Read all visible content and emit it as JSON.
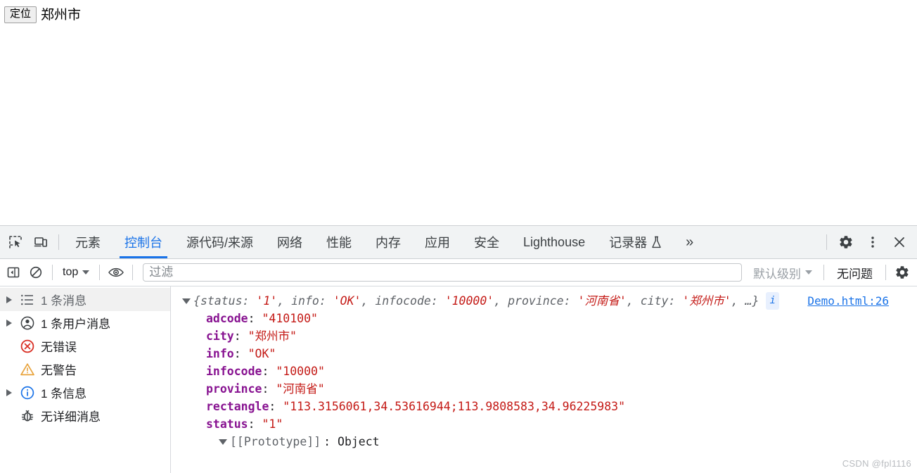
{
  "page": {
    "locate_button": "定位",
    "city_text": "郑州市"
  },
  "devtools": {
    "tabs": [
      {
        "label": "元素",
        "active": false
      },
      {
        "label": "控制台",
        "active": true
      },
      {
        "label": "源代码/来源",
        "active": false
      },
      {
        "label": "网络",
        "active": false
      },
      {
        "label": "性能",
        "active": false
      },
      {
        "label": "内存",
        "active": false
      },
      {
        "label": "应用",
        "active": false
      },
      {
        "label": "安全",
        "active": false
      },
      {
        "label": "Lighthouse",
        "active": false
      },
      {
        "label": "记录器",
        "active": false,
        "icon": "flask-icon"
      }
    ],
    "more_tabs": "»",
    "icons": {
      "inspect": "inspect-element-icon",
      "device": "device-toolbar-icon",
      "settings": "gear-icon",
      "kebab": "more-options-icon",
      "close": "close-icon"
    }
  },
  "console_toolbar": {
    "sidebar_toggle": "console-sidebar-toggle-icon",
    "clear": "clear-console-icon",
    "context": "top",
    "eye": "live-expression-icon",
    "filter_placeholder": "过滤",
    "filter_value": "",
    "level": "默认级别",
    "issues": "无问题",
    "settings": "gear-icon"
  },
  "sidebar": {
    "items": [
      {
        "label": "1 条消息",
        "icon": "list-icon",
        "expandable": true,
        "selected": true
      },
      {
        "label": "1 条用户消息",
        "icon": "user-icon",
        "expandable": true,
        "selected": false
      },
      {
        "label": "无错误",
        "icon": "error-icon",
        "expandable": false,
        "selected": false
      },
      {
        "label": "无警告",
        "icon": "warning-icon",
        "expandable": false,
        "selected": false
      },
      {
        "label": "1 条信息",
        "icon": "info-icon",
        "expandable": true,
        "selected": false
      },
      {
        "label": "无详细消息",
        "icon": "verbose-bug-icon",
        "expandable": false,
        "selected": false
      }
    ]
  },
  "console": {
    "source_link": "Demo.html:26",
    "info_badge": "i",
    "preview": {
      "open": "{",
      "parts": [
        {
          "key": "status: ",
          "value": "'1'"
        },
        {
          "key": "info: ",
          "value": "'OK'"
        },
        {
          "key": "infocode: ",
          "value": "'10000'"
        },
        {
          "key": "province: ",
          "value": "'河南省'"
        },
        {
          "key": "city: ",
          "value": "'郑州市'"
        }
      ],
      "ellipsis": ", …}"
    },
    "properties": [
      {
        "key": "adcode",
        "value": "\"410100\""
      },
      {
        "key": "city",
        "value": "\"郑州市\""
      },
      {
        "key": "info",
        "value": "\"OK\""
      },
      {
        "key": "infocode",
        "value": "\"10000\""
      },
      {
        "key": "province",
        "value": "\"河南省\""
      },
      {
        "key": "rectangle",
        "value": "\"113.3156061,34.53616944;113.9808583,34.96225983\""
      },
      {
        "key": "status",
        "value": "\"1\""
      }
    ],
    "prototype_key": "[[Prototype]]",
    "prototype_value": ": Object"
  },
  "watermark": "CSDN @fpl1116",
  "colors": {
    "accent": "#1a73e8",
    "string": "#c41a16",
    "property_key": "#881391",
    "error": "#d93025",
    "warning": "#e8a33d"
  }
}
